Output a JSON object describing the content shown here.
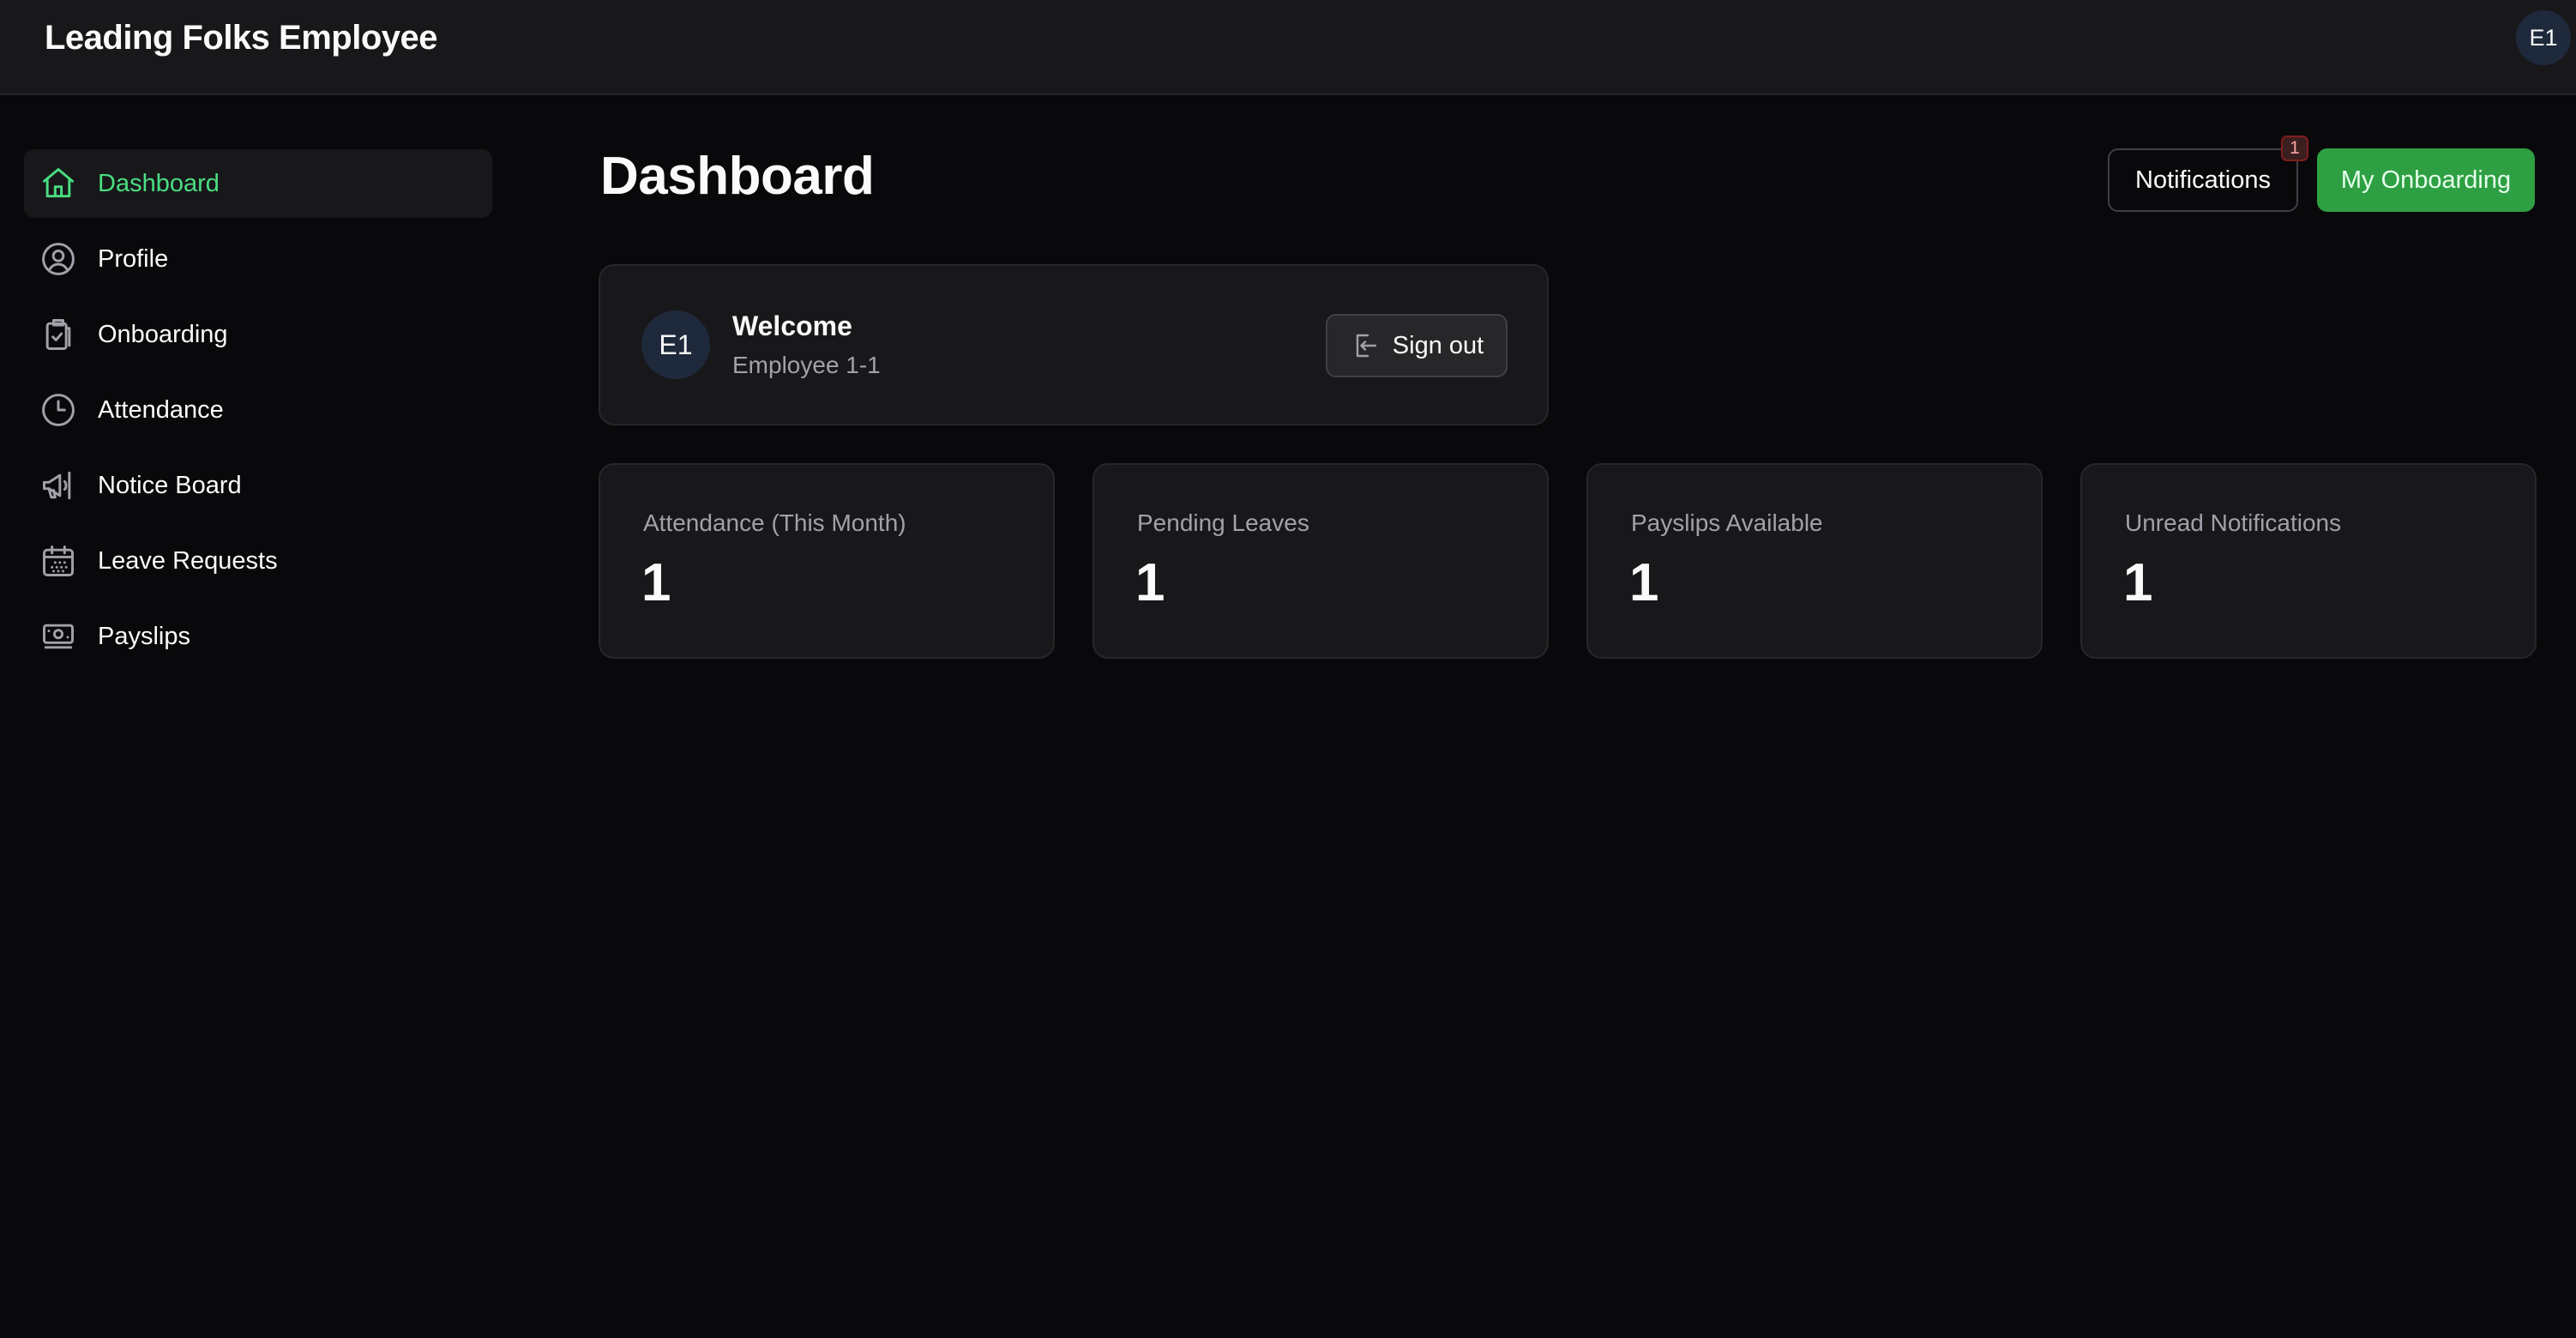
{
  "header": {
    "app_title": "Leading Folks Employee",
    "avatar_initials": "E1"
  },
  "sidebar": {
    "items": [
      {
        "label": "Dashboard",
        "icon": "home-icon",
        "active": true
      },
      {
        "label": "Profile",
        "icon": "user-circle-icon",
        "active": false
      },
      {
        "label": "Onboarding",
        "icon": "clipboard-check-icon",
        "active": false
      },
      {
        "label": "Attendance",
        "icon": "clock-icon",
        "active": false
      },
      {
        "label": "Notice Board",
        "icon": "megaphone-icon",
        "active": false
      },
      {
        "label": "Leave Requests",
        "icon": "calendar-icon",
        "active": false
      },
      {
        "label": "Payslips",
        "icon": "banknote-icon",
        "active": false
      }
    ]
  },
  "main": {
    "title": "Dashboard",
    "notifications_button": "Notifications",
    "notifications_badge": "1",
    "onboarding_button": "My Onboarding",
    "welcome": {
      "avatar_initials": "E1",
      "title": "Welcome",
      "subtitle": "Employee 1-1",
      "signout_label": "Sign out"
    },
    "stats": [
      {
        "label": "Attendance (This Month)",
        "value": "1"
      },
      {
        "label": "Pending Leaves",
        "value": "1"
      },
      {
        "label": "Payslips Available",
        "value": "1"
      },
      {
        "label": "Unread Notifications",
        "value": "1"
      }
    ]
  },
  "colors": {
    "background": "#09090b",
    "card": "#18181b",
    "accent_green": "#4ade80",
    "button_green": "#2ea043",
    "muted_text": "#a1a1aa"
  }
}
